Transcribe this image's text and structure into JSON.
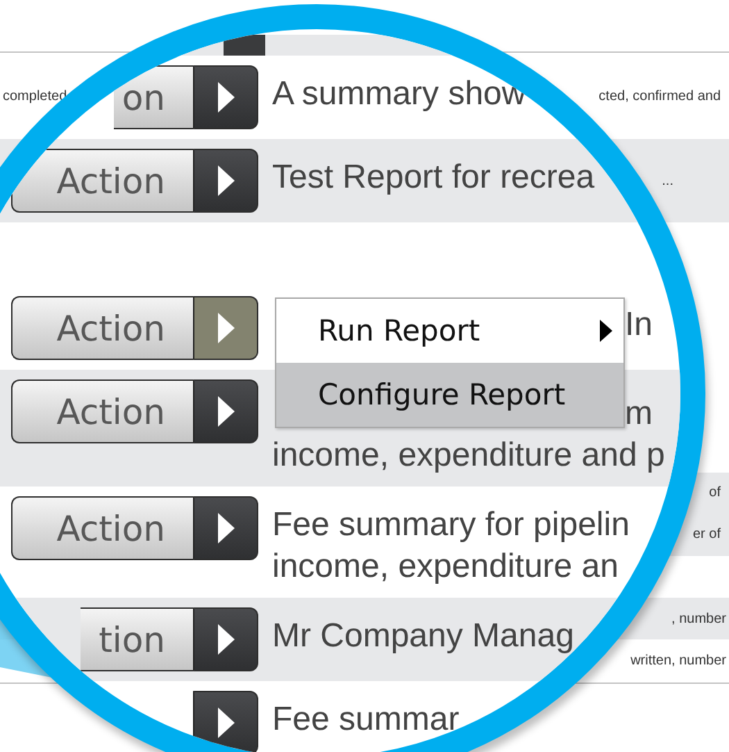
{
  "page_rows": [
    {},
    {
      "left": "completed",
      "right": "cted, confirmed and"
    },
    {
      "right": "..."
    },
    {},
    {
      "right": "of"
    },
    {
      "right": "er of"
    },
    {},
    {
      "right": ", number"
    },
    {
      "right": "written, number"
    },
    {}
  ],
  "lens": {
    "rows": [
      {
        "button": "on",
        "description": [
          "A summary show"
        ],
        "menu_open": false
      },
      {
        "button": "Action",
        "description": [
          "Test Report for recrea"
        ],
        "menu_open": false
      },
      {
        "button": "Action",
        "description": [
          "In"
        ],
        "menu_open": true
      },
      {
        "button": "Action",
        "description": [
          "m",
          "income, expenditure and p"
        ],
        "menu_open": false
      },
      {
        "button": "Action",
        "description": [
          "Fee summary for pipelin",
          "income, expenditure an"
        ],
        "menu_open": false
      },
      {
        "button": "tion",
        "description": [
          "Mr Company Manag"
        ],
        "menu_open": false
      },
      {
        "description": [
          "Fee summar"
        ],
        "menu_open": false
      }
    ],
    "menu": {
      "items": [
        {
          "label": "Run Report",
          "submenu": true,
          "selected": false
        },
        {
          "label": "Configure Report",
          "submenu": false,
          "selected": true
        }
      ]
    }
  }
}
